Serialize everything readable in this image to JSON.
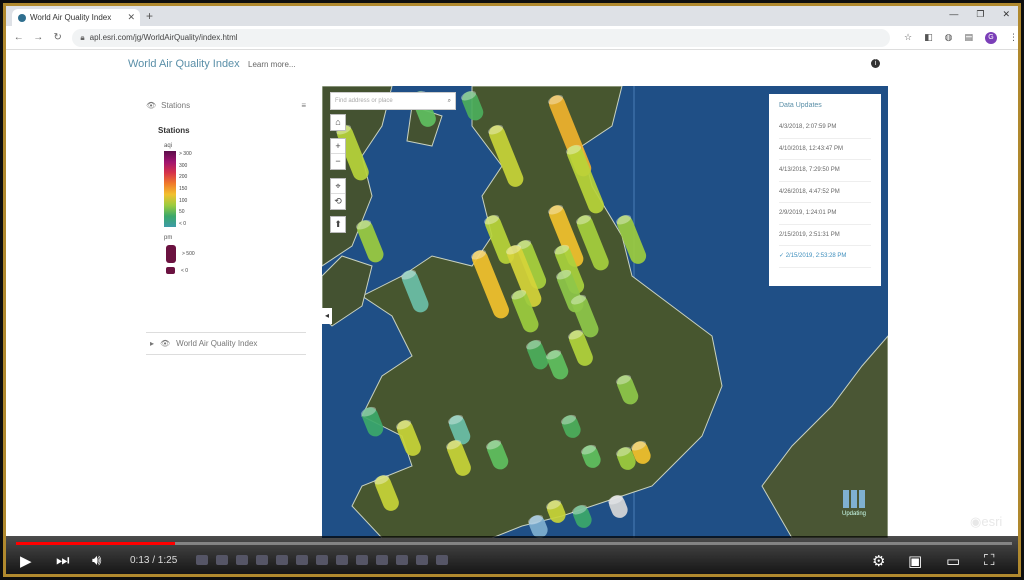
{
  "browser": {
    "tab_title": "World Air Quality Index",
    "url": "apl.esri.com/jg/WorldAirQuality/index.html"
  },
  "app": {
    "title": "World Air Quality Index",
    "learn_more": "Learn more...",
    "info_icon": "info-icon"
  },
  "panel": {
    "header": "Stations",
    "section_title": "Stations",
    "aqi_label": "aqi",
    "aqi_ticks": [
      "> 300",
      "300",
      "200",
      "150",
      "100",
      "50",
      "< 0"
    ],
    "pm_label": "pm",
    "pm_ticks": [
      "> 500",
      "< 0"
    ],
    "group_label": "World Air Quality Index"
  },
  "map": {
    "search_placeholder": "Find address or place",
    "updates": {
      "heading": "Data Updates",
      "dates": [
        "4/3/2018, 2:07:59 PM",
        "4/10/2018, 12:43:47 PM",
        "4/13/2018, 7:29:50 PM",
        "4/26/2018, 4:47:52 PM",
        "2/9/2019, 1:24:01 PM",
        "2/15/2019, 2:51:31 PM",
        "2/15/2019, 2:53:28 PM"
      ],
      "selected_index": 6
    },
    "updating_label": "Updating",
    "stations": [
      [
        20,
        40,
        0.6,
        "#b7d43a"
      ],
      [
        95,
        6,
        0.3,
        "#5fbf5f"
      ],
      [
        145,
        6,
        0.2,
        "#4cae5c"
      ],
      [
        172,
        40,
        0.7,
        "#c8d438"
      ],
      [
        232,
        10,
        1.0,
        "#f0b22e"
      ],
      [
        250,
        60,
        0.8,
        "#b9d43a"
      ],
      [
        40,
        135,
        0.4,
        "#9ccc3f"
      ],
      [
        200,
        155,
        0.5,
        "#a9d13e"
      ],
      [
        232,
        120,
        0.7,
        "#f2c12e"
      ],
      [
        260,
        130,
        0.6,
        "#a6cf3e"
      ],
      [
        300,
        130,
        0.5,
        "#9ccc3f"
      ],
      [
        168,
        130,
        0.5,
        "#b9d43a"
      ],
      [
        155,
        165,
        0.8,
        "#f2c12e"
      ],
      [
        190,
        160,
        0.7,
        "#d6d43a"
      ],
      [
        238,
        160,
        0.5,
        "#a9d13e"
      ],
      [
        240,
        185,
        0.4,
        "#8ec74a"
      ],
      [
        255,
        210,
        0.4,
        "#8ec74a"
      ],
      [
        195,
        205,
        0.4,
        "#9ccc3f"
      ],
      [
        252,
        245,
        0.3,
        "#b2d33c"
      ],
      [
        85,
        185,
        0.4,
        "#6bbfa8"
      ],
      [
        210,
        255,
        0.2,
        "#4cae5c"
      ],
      [
        230,
        265,
        0.2,
        "#5fbf5f"
      ],
      [
        300,
        290,
        0.2,
        "#8ec74a"
      ],
      [
        45,
        322,
        0.2,
        "#3ca86a"
      ],
      [
        80,
        335,
        0.3,
        "#c8d438"
      ],
      [
        132,
        330,
        0.2,
        "#6bbfa8"
      ],
      [
        130,
        355,
        0.3,
        "#c8d438"
      ],
      [
        170,
        355,
        0.2,
        "#5fbf5f"
      ],
      [
        245,
        330,
        0.1,
        "#4cae5c"
      ],
      [
        265,
        360,
        0.1,
        "#5fbf5f"
      ],
      [
        300,
        362,
        0.1,
        "#9ccc3f"
      ],
      [
        315,
        356,
        0.1,
        "#f2c12e"
      ],
      [
        58,
        390,
        0.3,
        "#c8d438"
      ],
      [
        230,
        415,
        0.1,
        "#c8d438"
      ],
      [
        256,
        420,
        0.1,
        "#3ca86a"
      ],
      [
        212,
        430,
        0.1,
        "#7fb0d0"
      ],
      [
        292,
        410,
        0.1,
        "#d8d8d8"
      ]
    ]
  },
  "player": {
    "time": "0:13 / 1:25",
    "progress": 0.16
  }
}
